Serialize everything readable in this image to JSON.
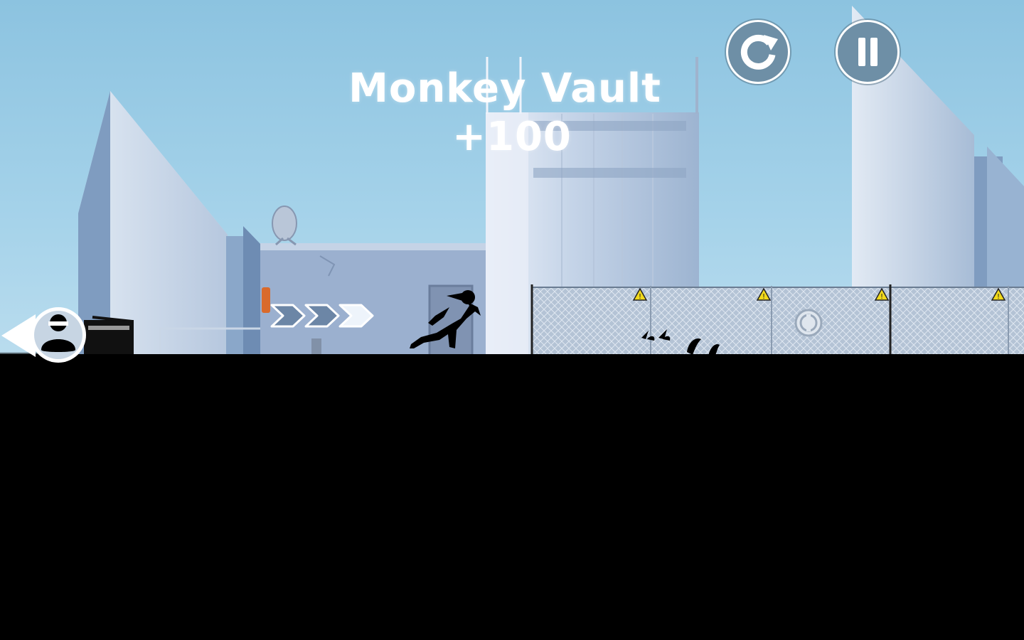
{
  "hud": {
    "trick_name": "Monkey Vault",
    "trick_points": "+100",
    "restart_icon": "restart-icon",
    "pause_icon": "pause-icon",
    "hunter_indicator_icon": "hunter-icon"
  },
  "scene": {
    "player": "runner-silhouette",
    "collectible": "coin-icon",
    "hazard_signs": "warning-sign-icon",
    "speed_arrows": "chevron-right-icon"
  },
  "colors": {
    "sky_top": "#8cc3e0",
    "sky_bottom": "#b9dcee",
    "button_fill": "#6e8fa6",
    "ground": "#000000",
    "text": "#ffffff"
  }
}
